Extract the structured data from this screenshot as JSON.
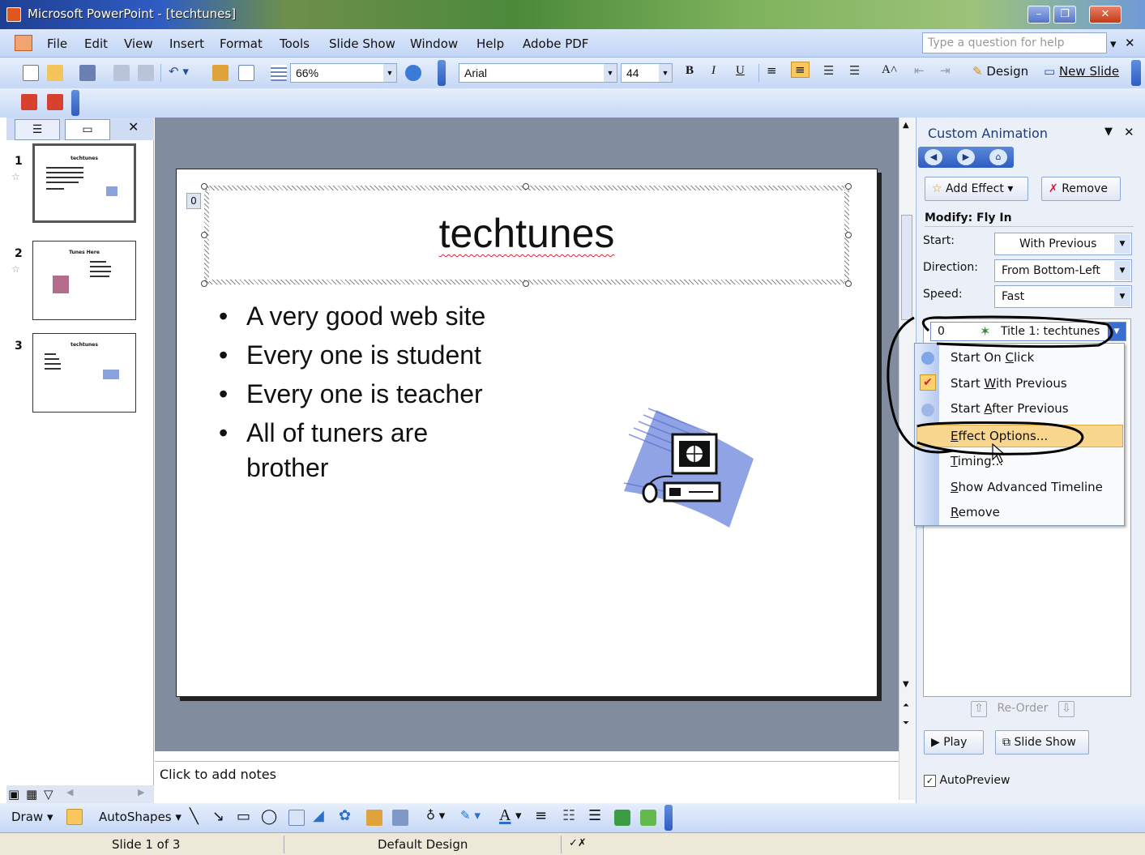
{
  "window": {
    "title": "Microsoft PowerPoint - [techtunes]",
    "controls": [
      "–",
      "❐",
      "✕"
    ]
  },
  "menu": {
    "items": [
      "File",
      "Edit",
      "View",
      "Insert",
      "Format",
      "Tools",
      "Slide Show",
      "Window",
      "Help",
      "Adobe PDF"
    ],
    "help_placeholder": "Type a question for help"
  },
  "toolbar": {
    "zoom": "66%",
    "font": "Arial",
    "font_size": "44",
    "bold": "B",
    "italic": "I",
    "underline": "U",
    "design_label": "Design",
    "new_slide_label": "New Slide"
  },
  "slides_pane": {
    "slides": [
      {
        "num": "1",
        "title": "techtunes"
      },
      {
        "num": "2",
        "title": "Tunes Here"
      },
      {
        "num": "3",
        "title": "techtunes"
      }
    ]
  },
  "slide": {
    "anim_tag": "0",
    "title": "techtunes",
    "bullets": [
      "A very good web site",
      "Every one is student",
      "Every one is teacher",
      "All of tuners are",
      "brother"
    ]
  },
  "notes": {
    "placeholder": "Click to add notes"
  },
  "task_pane": {
    "title": "Custom Animation",
    "add_effect": "Add Effect",
    "remove": "Remove",
    "modify": "Modify: Fly In",
    "start_label": "Start:",
    "start_value": "With Previous",
    "direction_label": "Direction:",
    "direction_value": "From Bottom-Left",
    "speed_label": "Speed:",
    "speed_value": "Fast",
    "item": {
      "num": "0",
      "label": "Title 1: techtunes"
    },
    "reorder": "Re-Order",
    "play": "Play",
    "slide_show": "Slide Show",
    "autopreview": "AutoPreview"
  },
  "context_menu": {
    "items": [
      {
        "pre": "Start On ",
        "key": "C",
        "post": "lick"
      },
      {
        "pre": "Start ",
        "key": "W",
        "post": "ith Previous"
      },
      {
        "pre": "Start ",
        "key": "A",
        "post": "fter Previous"
      },
      {
        "pre": "",
        "key": "E",
        "post": "ffect Options..."
      },
      {
        "pre": "",
        "key": "T",
        "post": "iming..."
      },
      {
        "pre": "",
        "key": "S",
        "post": "how Advanced Timeline"
      },
      {
        "pre": "",
        "key": "R",
        "post": "emove"
      }
    ]
  },
  "drawbar": {
    "draw": "Draw",
    "autoshapes": "AutoShapes"
  },
  "status": {
    "slide": "Slide 1 of 3",
    "design": "Default Design"
  },
  "colors": {
    "accent": "#2f5cc3",
    "highlight": "#f8d68e",
    "edit_area": "#828c9f"
  }
}
